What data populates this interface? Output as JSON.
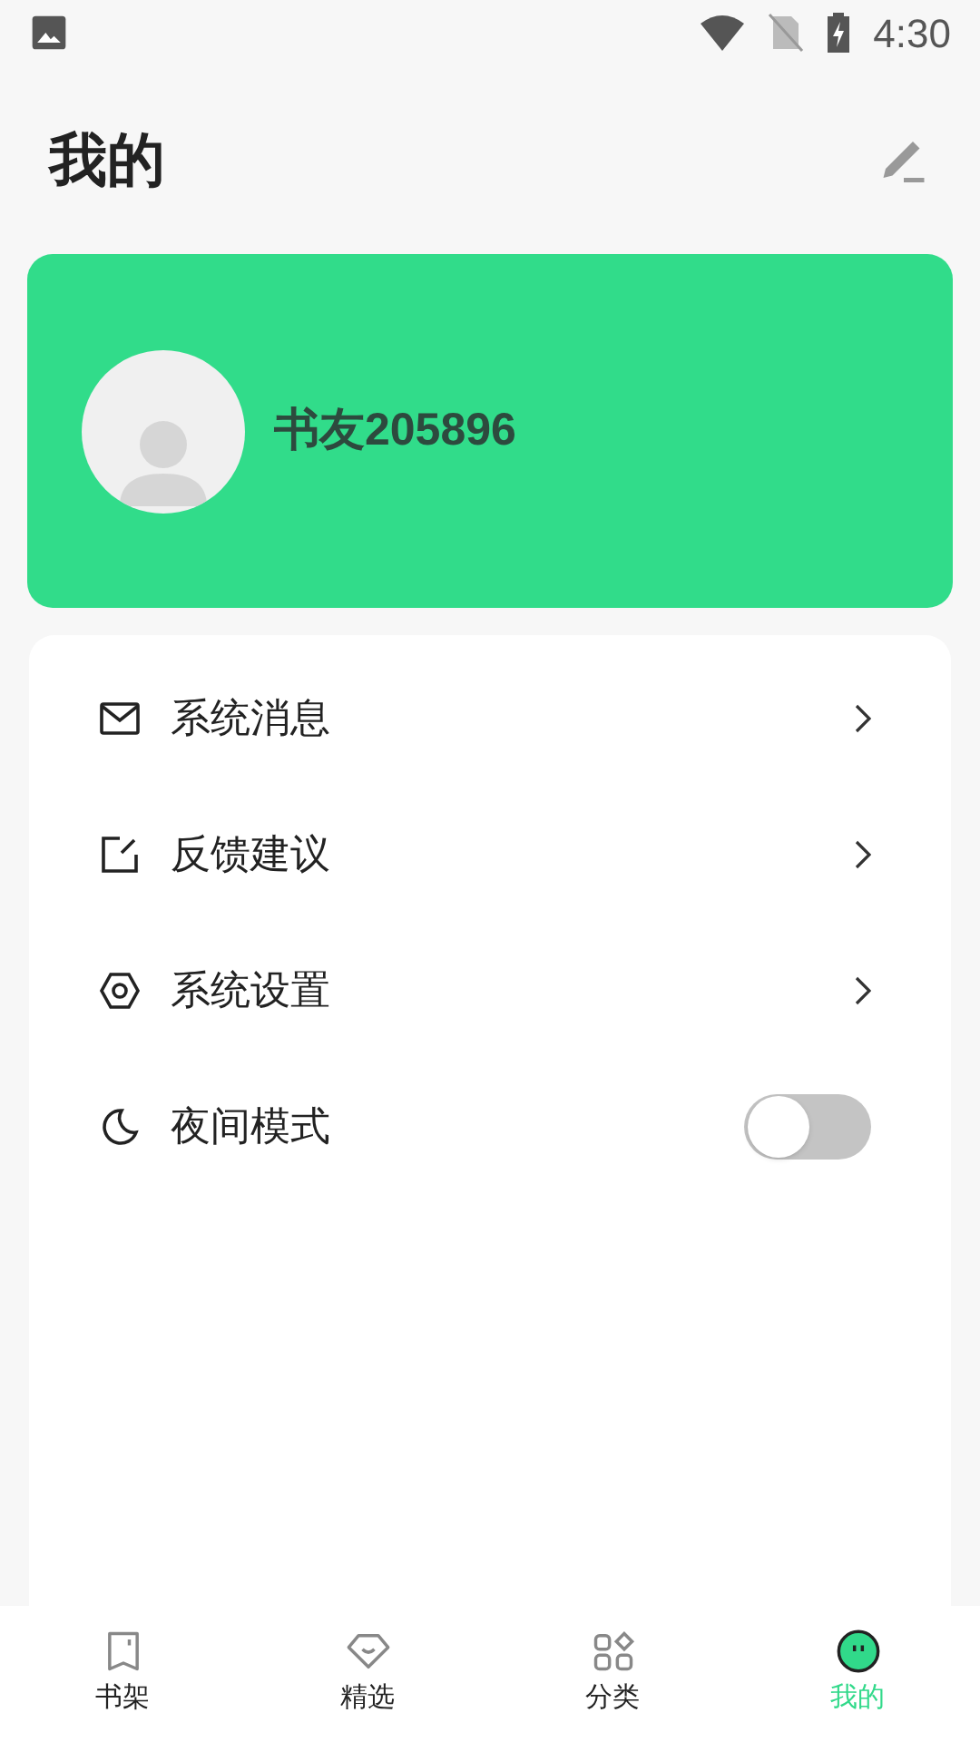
{
  "status_bar": {
    "time": "4:30"
  },
  "header": {
    "title": "我的"
  },
  "profile": {
    "name": "书友205896"
  },
  "menu": [
    {
      "kind": "link",
      "label": "系统消息"
    },
    {
      "kind": "link",
      "label": "反馈建议"
    },
    {
      "kind": "link",
      "label": "系统设置"
    },
    {
      "kind": "toggle",
      "label": "夜间模式",
      "on": false
    }
  ],
  "tabs": [
    {
      "label": "书架",
      "selected": false
    },
    {
      "label": "精选",
      "selected": false
    },
    {
      "label": "分类",
      "selected": false
    },
    {
      "label": "我的",
      "selected": true
    }
  ]
}
